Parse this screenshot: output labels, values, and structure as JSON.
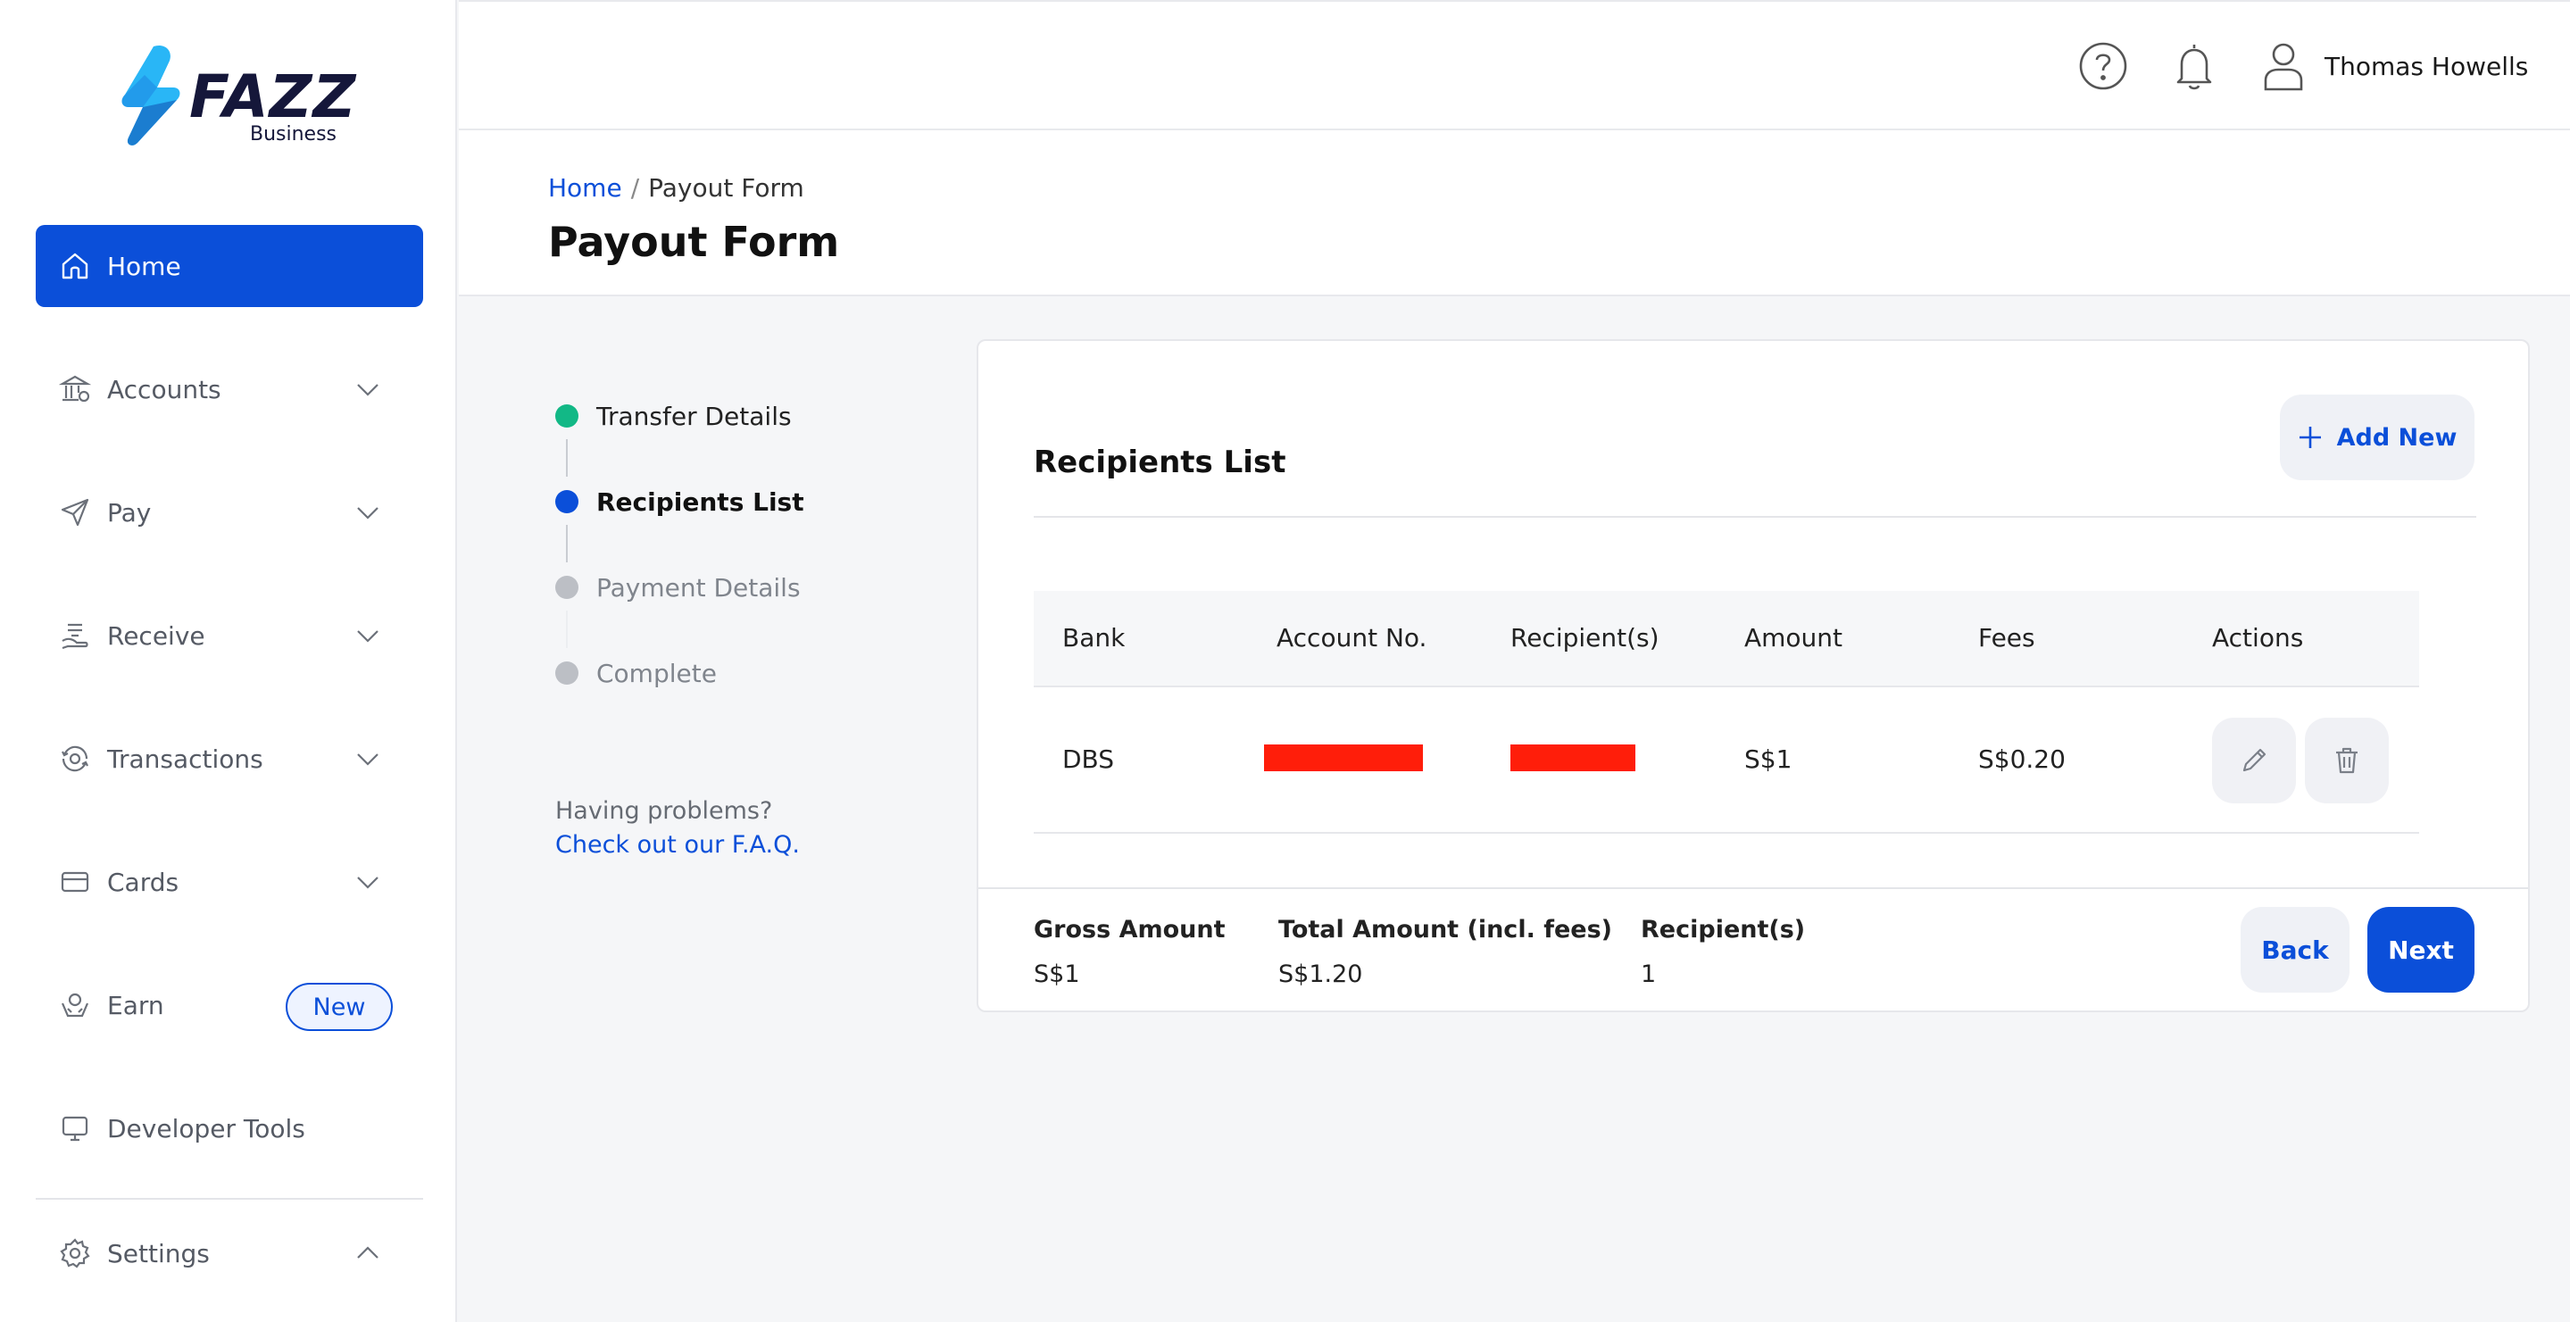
{
  "brand": {
    "name": "FAZZ",
    "subtitle": "Business"
  },
  "sidebar": {
    "items": [
      {
        "label": "Home",
        "icon": "home-icon",
        "active": true
      },
      {
        "label": "Accounts",
        "icon": "bank-icon",
        "expandable": true
      },
      {
        "label": "Pay",
        "icon": "send-icon",
        "expandable": true
      },
      {
        "label": "Receive",
        "icon": "receive-icon",
        "expandable": true
      },
      {
        "label": "Transactions",
        "icon": "transactions-icon",
        "expandable": true
      },
      {
        "label": "Cards",
        "icon": "card-icon",
        "expandable": true
      },
      {
        "label": "Earn",
        "icon": "earn-icon",
        "badge": "New"
      },
      {
        "label": "Developer Tools",
        "icon": "monitor-icon"
      },
      {
        "label": "Settings",
        "icon": "gear-icon",
        "expanded": true
      }
    ]
  },
  "topbar": {
    "help_icon": "help-icon",
    "notification_icon": "bell-icon",
    "user_icon": "user-icon",
    "user_name": "Thomas Howells"
  },
  "header": {
    "breadcrumb": {
      "home": "Home",
      "separator": "/",
      "current": "Payout Form"
    },
    "title": "Payout Form"
  },
  "stepper": {
    "steps": [
      {
        "label": "Transfer Details",
        "state": "done"
      },
      {
        "label": "Recipients List",
        "state": "active"
      },
      {
        "label": "Payment Details",
        "state": "pending"
      },
      {
        "label": "Complete",
        "state": "pending"
      }
    ]
  },
  "help": {
    "text": "Having problems?",
    "link": "Check out our F.A.Q."
  },
  "recipients": {
    "title": "Recipients List",
    "add_new_label": "Add New",
    "columns": [
      "Bank",
      "Account No.",
      "Recipient(s)",
      "Amount",
      "Fees",
      "Actions"
    ],
    "rows": [
      {
        "bank": "DBS",
        "account_no": "",
        "recipient": "",
        "amount": "S$1",
        "fees": "S$0.20"
      }
    ]
  },
  "summary": {
    "gross_label": "Gross Amount",
    "gross_value": "S$1",
    "total_label": "Total Amount (incl. fees)",
    "total_value": "S$1.20",
    "recipients_label": "Recipient(s)",
    "recipients_value": "1"
  },
  "actions": {
    "back_label": "Back",
    "next_label": "Next"
  },
  "colors": {
    "primary": "#0b4fd9",
    "step_done": "#12b886",
    "step_pending": "#bcbfc5",
    "redaction": "#ff1e0a",
    "logo_bolt": "#29b6f6"
  }
}
